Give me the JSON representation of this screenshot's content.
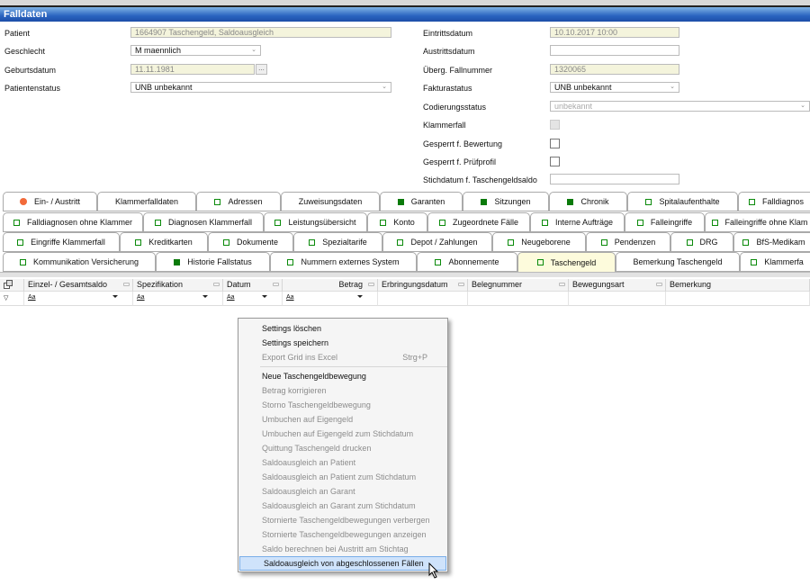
{
  "window": {
    "title": "Falldaten"
  },
  "form_left": [
    {
      "label": "Patient",
      "value": "1664907 Taschengeld, Saldoausgleich",
      "kind": "readonly"
    },
    {
      "label": "Geschlecht",
      "value": "M maennlich",
      "kind": "select"
    },
    {
      "label": "Geburtsdatum",
      "value": "11.11.1981",
      "kind": "readonly-date",
      "button": "..."
    },
    {
      "label": "Patientenstatus",
      "value": "UNB unbekannt",
      "kind": "select"
    }
  ],
  "form_right": [
    {
      "label": "Eintrittsdatum",
      "value": "10.10.2017 10:00",
      "kind": "readonly"
    },
    {
      "label": "Austrittsdatum",
      "value": "",
      "kind": "text"
    },
    {
      "label": "Überg. Fallnummer",
      "value": "1320065",
      "kind": "readonly"
    },
    {
      "label": "Fakturastatus",
      "value": "UNB unbekannt",
      "kind": "select"
    },
    {
      "label": "Codierungsstatus",
      "value": "unbekannt",
      "kind": "select-disabled"
    },
    {
      "label": "Klammerfall",
      "checked": false,
      "kind": "checkbox-disabled"
    },
    {
      "label": "Gesperrt f. Bewertung",
      "checked": false,
      "kind": "checkbox"
    },
    {
      "label": "Gesperrt f. Prüfprofil",
      "checked": false,
      "kind": "checkbox"
    },
    {
      "label": "Stichdatum f. Taschengeldsaldo",
      "value": "",
      "kind": "text"
    }
  ],
  "tabs": [
    [
      {
        "label": "Ein- / Austritt",
        "icon": "dot"
      },
      {
        "label": "Klammerfalldaten",
        "icon": "none"
      },
      {
        "label": "Adressen",
        "icon": "outline"
      },
      {
        "label": "Zuweisungsdaten",
        "icon": "none"
      },
      {
        "label": "Garanten",
        "icon": "filled"
      },
      {
        "label": "Sitzungen",
        "icon": "filled"
      },
      {
        "label": "Chronik",
        "icon": "filled"
      },
      {
        "label": "Spitalaufenthalte",
        "icon": "outline"
      },
      {
        "label": "Falldiagnos",
        "icon": "outline"
      }
    ],
    [
      {
        "label": "Falldiagnosen ohne Klammer",
        "icon": "outline"
      },
      {
        "label": "Diagnosen Klammerfall",
        "icon": "outline"
      },
      {
        "label": "Leistungsübersicht",
        "icon": "outline"
      },
      {
        "label": "Konto",
        "icon": "outline"
      },
      {
        "label": "Zugeordnete Fälle",
        "icon": "outline"
      },
      {
        "label": "Interne Aufträge",
        "icon": "outline"
      },
      {
        "label": "Falleingriffe",
        "icon": "outline"
      },
      {
        "label": "Falleingriffe ohne Klam",
        "icon": "outline"
      }
    ],
    [
      {
        "label": "Eingriffe Klammerfall",
        "icon": "outline"
      },
      {
        "label": "Kreditkarten",
        "icon": "outline"
      },
      {
        "label": "Dokumente",
        "icon": "outline"
      },
      {
        "label": "Spezialtarife",
        "icon": "outline"
      },
      {
        "label": "Depot / Zahlungen",
        "icon": "outline"
      },
      {
        "label": "Neugeborene",
        "icon": "outline"
      },
      {
        "label": "Pendenzen",
        "icon": "outline"
      },
      {
        "label": "DRG",
        "icon": "outline"
      },
      {
        "label": "BfS-Medikam",
        "icon": "outline"
      }
    ],
    [
      {
        "label": "Kommunikation Versicherung",
        "icon": "outline"
      },
      {
        "label": "Historie Fallstatus",
        "icon": "filled"
      },
      {
        "label": "Nummern externes System",
        "icon": "outline"
      },
      {
        "label": "Abonnemente",
        "icon": "outline"
      },
      {
        "label": "Taschengeld",
        "icon": "outline",
        "active": true
      },
      {
        "label": "Bemerkung Taschengeld",
        "icon": "none"
      },
      {
        "label": "Klammerfa",
        "icon": "outline"
      }
    ]
  ],
  "grid": {
    "columns": [
      "Einzel- / Gesamtsaldo",
      "Spezifikation",
      "Datum",
      "Betrag",
      "Erbringungsdatum",
      "Belegnummer",
      "Bewegungsart",
      "Bemerkung"
    ],
    "filter_placeholder": "Aa"
  },
  "context_menu": [
    {
      "label": "Settings löschen",
      "enabled": true
    },
    {
      "label": "Settings speichern",
      "enabled": true
    },
    {
      "label": "Export Grid ins Excel",
      "enabled": false,
      "shortcut": "Strg+P"
    },
    {
      "separator": true
    },
    {
      "label": "Neue Taschengeldbewegung",
      "enabled": true
    },
    {
      "label": "Betrag korrigieren",
      "enabled": false
    },
    {
      "label": "Storno Taschengeldbewegung",
      "enabled": false
    },
    {
      "label": "Umbuchen auf Eigengeld",
      "enabled": false
    },
    {
      "label": "Umbuchen auf Eigengeld zum Stichdatum",
      "enabled": false
    },
    {
      "label": "Quittung Taschengeld drucken",
      "enabled": false
    },
    {
      "label": "Saldoausgleich an Patient",
      "enabled": false
    },
    {
      "label": "Saldoausgleich an Patient zum Stichdatum",
      "enabled": false
    },
    {
      "label": "Saldoausgleich an Garant",
      "enabled": false
    },
    {
      "label": "Saldoausgleich an Garant zum Stichdatum",
      "enabled": false
    },
    {
      "label": "Stornierte Taschengeldbewegungen verbergen",
      "enabled": false
    },
    {
      "label": "Stornierte Taschengeldbewegungen anzeigen",
      "enabled": false
    },
    {
      "label": "Saldo berechnen bei Austritt am Stichtag",
      "enabled": false
    },
    {
      "label": "Saldoausgleich von abgeschlossenen Fällen",
      "enabled": true,
      "highlighted": true
    }
  ]
}
